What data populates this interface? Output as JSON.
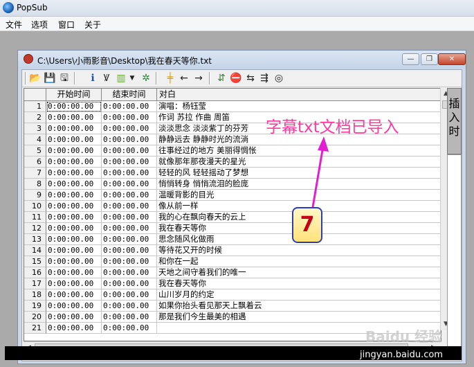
{
  "app": {
    "title": "PopSub"
  },
  "menu": [
    "文件",
    "选项",
    "窗口",
    "关于"
  ],
  "child_window": {
    "path": "C:\\Users\\小雨影音\\Desktop\\我在春天等你.txt",
    "minimize": "—",
    "restore": "❐",
    "close": "✕"
  },
  "toolbar_icons": [
    "open-icon",
    "save-icon",
    "save-as-icon",
    "info-icon",
    "spell-icon",
    "chart-icon",
    "settings-icon",
    "insert-line-icon",
    "arrow-left-icon",
    "arrow-right-icon",
    "stop-icon",
    "sync-icon",
    "convert-icon",
    "preview-icon"
  ],
  "grid": {
    "headers": [
      "",
      "开始时间",
      "结束时间",
      "对白"
    ],
    "rows": [
      {
        "n": "1",
        "start": "0:00:00.00",
        "end": "0:00:00.00",
        "text": "演唱：杨钰莹"
      },
      {
        "n": "2",
        "start": "0:00:00.00",
        "end": "0:00:00.00",
        "text": "作词 苏拉 作曲 周笛"
      },
      {
        "n": "3",
        "start": "0:00:00.00",
        "end": "0:00:00.00",
        "text": "淡淡思念 淡淡紫丁的芬芳"
      },
      {
        "n": "4",
        "start": "0:00:00.00",
        "end": "0:00:00.00",
        "text": "静静远去 静静时光的流淌"
      },
      {
        "n": "5",
        "start": "0:00:00.00",
        "end": "0:00:00.00",
        "text": "往事经过的地方 美丽得惆怅"
      },
      {
        "n": "6",
        "start": "0:00:00.00",
        "end": "0:00:00.00",
        "text": "就像那年那夜漫天的星光"
      },
      {
        "n": "7",
        "start": "0:00:00.00",
        "end": "0:00:00.00",
        "text": "轻轻的风 轻轻摇动了梦想"
      },
      {
        "n": "8",
        "start": "0:00:00.00",
        "end": "0:00:00.00",
        "text": "悄悄转身 悄悄流泪的脸庞"
      },
      {
        "n": "9",
        "start": "0:00:00.00",
        "end": "0:00:00.00",
        "text": "温暖背影的目光"
      },
      {
        "n": "10",
        "start": "0:00:00.00",
        "end": "0:00:00.00",
        "text": "像从前一样"
      },
      {
        "n": "11",
        "start": "0:00:00.00",
        "end": "0:00:00.00",
        "text": "我的心在飘向春天的云上"
      },
      {
        "n": "12",
        "start": "0:00:00.00",
        "end": "0:00:00.00",
        "text": "我在春天等你"
      },
      {
        "n": "13",
        "start": "0:00:00.00",
        "end": "0:00:00.00",
        "text": "思念随风化做雨"
      },
      {
        "n": "14",
        "start": "0:00:00.00",
        "end": "0:00:00.00",
        "text": "等待花又开的时候"
      },
      {
        "n": "15",
        "start": "0:00:00.00",
        "end": "0:00:00.00",
        "text": "和你在一起"
      },
      {
        "n": "16",
        "start": "0:00:00.00",
        "end": "0:00:00.00",
        "text": "天地之间守着我们的唯一"
      },
      {
        "n": "17",
        "start": "0:00:00.00",
        "end": "0:00:00.00",
        "text": "我在春天等你"
      },
      {
        "n": "18",
        "start": "0:00:00.00",
        "end": "0:00:00.00",
        "text": "山川岁月的约定"
      },
      {
        "n": "19",
        "start": "0:00:00.00",
        "end": "0:00:00.00",
        "text": "如果你抬头看见那天上飘着云"
      },
      {
        "n": "20",
        "start": "0:00:00.00",
        "end": "0:00:00.00",
        "text": "那是我们今生最美的相遇"
      },
      {
        "n": "21",
        "start": "0:00:00.00",
        "end": "0:00:00.00",
        "text": ""
      }
    ]
  },
  "insert_button": "插入时",
  "annotation": {
    "text": "字幕txt文档已导入",
    "step": "7"
  },
  "watermark": "jingyan.baidu.com",
  "baidu_logo": "Baidu 经验",
  "colors": {
    "annotation": "#ff3a9d",
    "arrow": "#e020d0",
    "step_border": "#2a3fb6"
  }
}
